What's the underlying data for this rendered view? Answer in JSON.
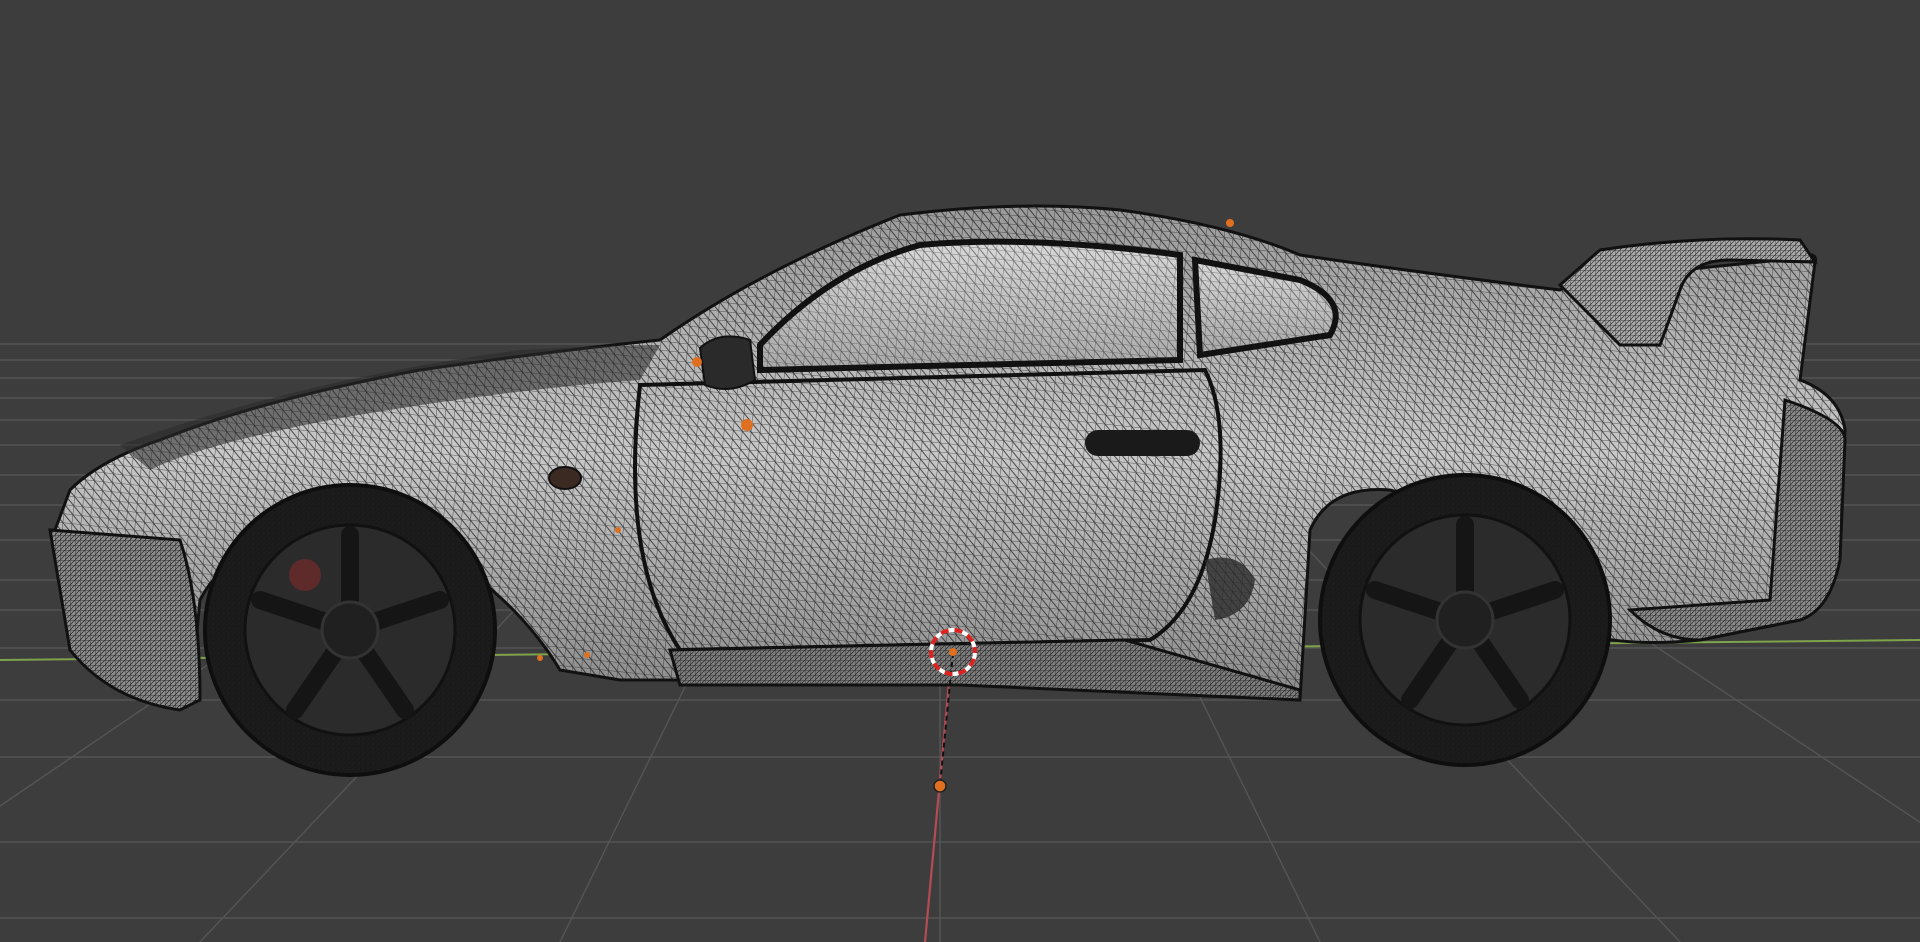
{
  "viewport": {
    "mode": "3D viewport",
    "shading": "wireframe",
    "object": "car-model",
    "colors": {
      "background": "#3d3d3d",
      "grid": "#555555",
      "x_axis": "#b44b55",
      "y_axis": "#7ea34a",
      "selection": "#e07020",
      "mesh_fill": "#b8b8b8",
      "wire": "#111111"
    },
    "icons": [
      "3d-cursor-icon",
      "origin-point-icon"
    ]
  }
}
